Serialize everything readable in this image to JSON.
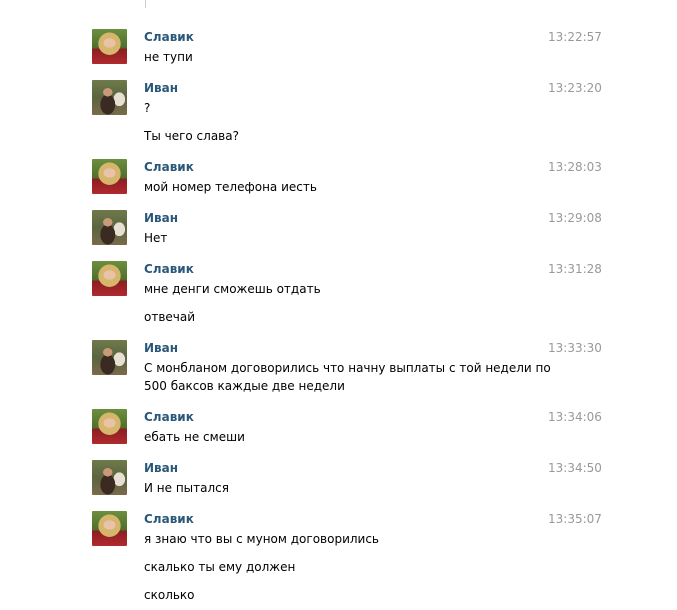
{
  "messages": [
    {
      "author": "Славик",
      "time": "13:22:57",
      "lines": [
        "не тупи"
      ]
    },
    {
      "author": "Иван",
      "time": "13:23:20",
      "lines": [
        "?",
        "Ты чего слава?"
      ]
    },
    {
      "author": "Славик",
      "time": "13:28:03",
      "lines": [
        "мой номер телефона иесть"
      ]
    },
    {
      "author": "Иван",
      "time": "13:29:08",
      "lines": [
        "Нет"
      ]
    },
    {
      "author": "Славик",
      "time": "13:31:28",
      "lines": [
        "мне денги сможешь отдать",
        "отвечай"
      ]
    },
    {
      "author": "Иван",
      "time": "13:33:30",
      "lines": [
        "С монбланом договорились что начну выплаты с той недели по",
        "500 баксов каждые две недели"
      ]
    },
    {
      "author": "Славик",
      "time": "13:34:06",
      "lines": [
        "ебать не смеши"
      ]
    },
    {
      "author": "Иван",
      "time": "13:34:50",
      "lines": [
        "И не пытался"
      ]
    },
    {
      "author": "Славик",
      "time": "13:35:07",
      "lines": [
        "я знаю что вы с муном договорились",
        "скалько ты ему должен",
        "сколько"
      ]
    }
  ]
}
